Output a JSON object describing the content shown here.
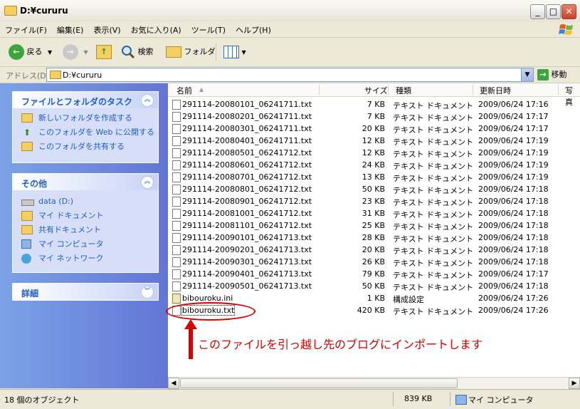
{
  "window": {
    "title": "D:¥cururu"
  },
  "menu": [
    "ファイル(F)",
    "編集(E)",
    "表示(V)",
    "お気に入り(A)",
    "ツール(T)",
    "ヘルプ(H)"
  ],
  "toolbar": {
    "back": "戻る",
    "search": "検索",
    "folders": "フォルダ"
  },
  "address": {
    "label": "アドレス(D)",
    "value": "D:¥cururu",
    "go": "移動"
  },
  "tasks": {
    "file_folder": {
      "title": "ファイルとフォルダのタスク",
      "items": [
        "新しいフォルダを作成する",
        "このフォルダを Web に公開する",
        "このフォルダを共有する"
      ]
    },
    "other": {
      "title": "その他",
      "items": [
        "data (D:)",
        "マイ ドキュメント",
        "共有ドキュメント",
        "マイ コンピュータ",
        "マイ ネットワーク"
      ]
    },
    "details": {
      "title": "詳細"
    }
  },
  "columns": {
    "name": "名前",
    "size": "サイズ",
    "type": "種類",
    "modified": "更新日時",
    "extra": "写真"
  },
  "files": [
    {
      "name": "291114-20080101_06241711.txt",
      "size": "7 KB",
      "type": "テキスト ドキュメント",
      "date": "2009/06/24 17:16"
    },
    {
      "name": "291114-20080201_06241711.txt",
      "size": "7 KB",
      "type": "テキスト ドキュメント",
      "date": "2009/06/24 17:17"
    },
    {
      "name": "291114-20080301_06241711.txt",
      "size": "20 KB",
      "type": "テキスト ドキュメント",
      "date": "2009/06/24 17:17"
    },
    {
      "name": "291114-20080401_06241711.txt",
      "size": "12 KB",
      "type": "テキスト ドキュメント",
      "date": "2009/06/24 17:19"
    },
    {
      "name": "291114-20080501_06241712.txt",
      "size": "12 KB",
      "type": "テキスト ドキュメント",
      "date": "2009/06/24 17:19"
    },
    {
      "name": "291114-20080601_06241712.txt",
      "size": "24 KB",
      "type": "テキスト ドキュメント",
      "date": "2009/06/24 17:19"
    },
    {
      "name": "291114-20080701_06241712.txt",
      "size": "13 KB",
      "type": "テキスト ドキュメント",
      "date": "2009/06/24 17:19"
    },
    {
      "name": "291114-20080801_06241712.txt",
      "size": "50 KB",
      "type": "テキスト ドキュメント",
      "date": "2009/06/24 17:18"
    },
    {
      "name": "291114-20080901_06241712.txt",
      "size": "23 KB",
      "type": "テキスト ドキュメント",
      "date": "2009/06/24 17:18"
    },
    {
      "name": "291114-20081001_06241712.txt",
      "size": "31 KB",
      "type": "テキスト ドキュメント",
      "date": "2009/06/24 17:18"
    },
    {
      "name": "291114-20081101_06241712.txt",
      "size": "25 KB",
      "type": "テキスト ドキュメント",
      "date": "2009/06/24 17:18"
    },
    {
      "name": "291114-20090101_06241713.txt",
      "size": "28 KB",
      "type": "テキスト ドキュメント",
      "date": "2009/06/24 17:18"
    },
    {
      "name": "291114-20090201_06241713.txt",
      "size": "20 KB",
      "type": "テキスト ドキュメント",
      "date": "2009/06/24 17:18"
    },
    {
      "name": "291114-20090301_06241713.txt",
      "size": "26 KB",
      "type": "テキスト ドキュメント",
      "date": "2009/06/24 17:18"
    },
    {
      "name": "291114-20090401_06241713.txt",
      "size": "79 KB",
      "type": "テキスト ドキュメント",
      "date": "2009/06/24 17:17"
    },
    {
      "name": "291114-20090501_06241713.txt",
      "size": "50 KB",
      "type": "テキスト ドキュメント",
      "date": "2009/06/24 17:18"
    },
    {
      "name": "bibouroku.ini",
      "size": "1 KB",
      "type": "構成設定",
      "date": "2009/06/24 17:26"
    },
    {
      "name": "bibouroku.txt",
      "size": "420 KB",
      "type": "テキスト ドキュメント",
      "date": "2009/06/24 17:26"
    }
  ],
  "annotation": "このファイルを引っ越し先のブログにインポートします",
  "status": {
    "count": "18 個のオブジェクト",
    "size": "839 KB",
    "location": "マイ コンピュータ"
  },
  "colors": {
    "annotation": "#d40000",
    "task_link": "#215dc6",
    "pane_gradient_start": "#7ba2e7",
    "pane_gradient_end": "#6375d6"
  }
}
